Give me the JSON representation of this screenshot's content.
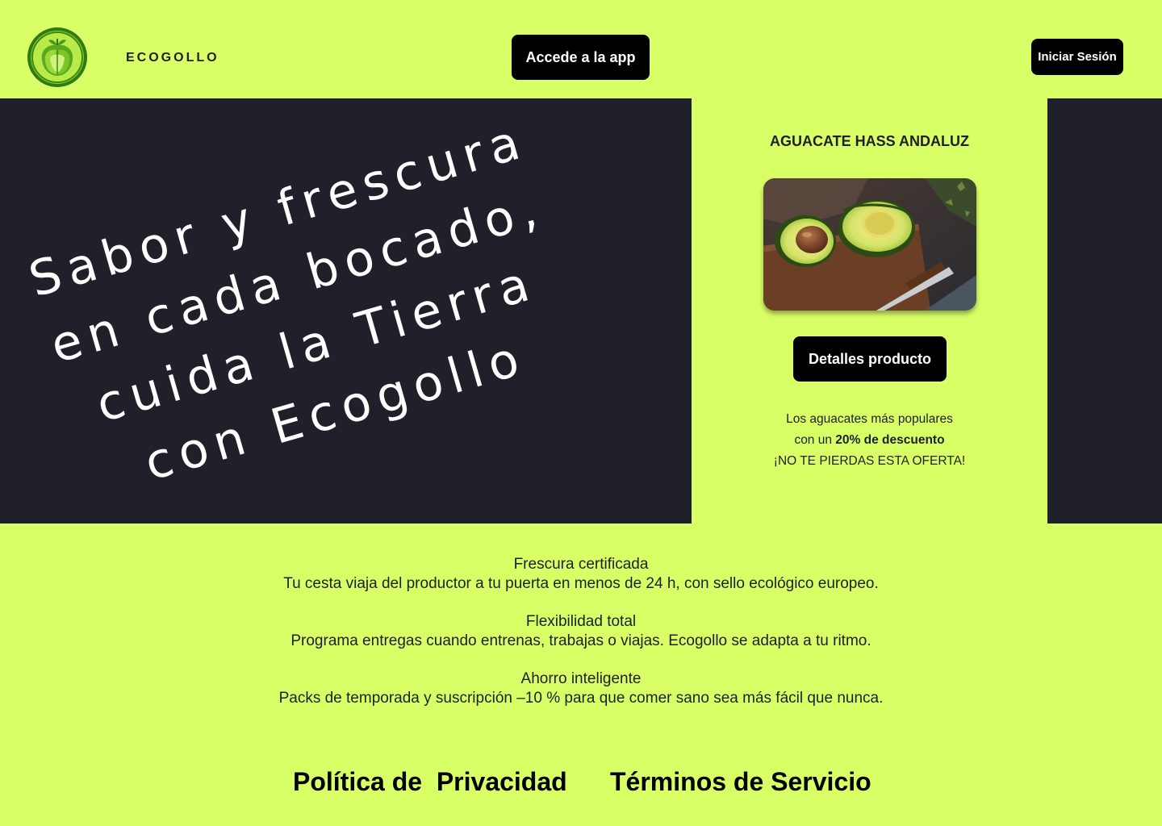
{
  "header": {
    "brand": "ECOGOLLO",
    "logo_icon": "lettuce-logo-icon",
    "app_button": "Accede a la app",
    "login_button": "Iniciar Sesión"
  },
  "hero": {
    "headline": "Sabor y frescura\nen cada bocado,\ncuida la Tierra\ncon Ecogollo"
  },
  "product": {
    "title": "AGUACATE HASS ANDALUZ",
    "image_icon": "avocado-image",
    "details_button": "Detalles producto",
    "promo_line1": "Los aguacates más populares",
    "promo_line2_prefix": "con un ",
    "promo_line2_bold": "20% de descuento",
    "promo_line3": "¡NO TE PIERDAS ESTA OFERTA!"
  },
  "features": [
    {
      "title": "Frescura certificada",
      "text": "Tu cesta viaja del productor a tu puerta en menos de 24 h, con sello ecológico europeo."
    },
    {
      "title": "Flexibilidad total",
      "text": "Programa entregas cuando entrenas, trabajas o viajas. Ecogollo se adapta a tu ritmo."
    },
    {
      "title": "Ahorro inteligente",
      "text": "Packs de temporada y suscripción –10 % para que comer sano sea más fácil que nunca."
    }
  ],
  "footer": {
    "privacy": "Política de  Privacidad",
    "terms": "Términos de Servicio"
  },
  "colors": {
    "background": "#d9ff66",
    "dark_panel": "#1f2029",
    "button": "#000000",
    "button_text": "#ffffff"
  }
}
